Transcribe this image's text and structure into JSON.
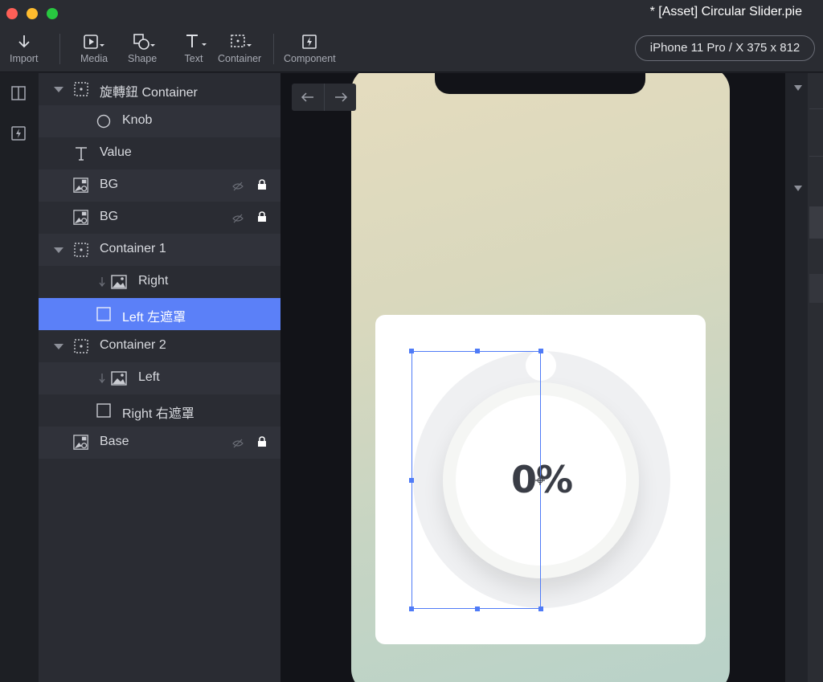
{
  "window": {
    "title": "* [Asset] Circular Slider.pie"
  },
  "toolbar": {
    "import_label": "Import",
    "media_label": "Media",
    "shape_label": "Shape",
    "text_label": "Text",
    "container_label": "Container",
    "component_label": "Component",
    "device_label": "iPhone 11 Pro / X  375 x 812"
  },
  "layers": [
    {
      "name": "旋轉鈕 Container",
      "icon": "container-icon",
      "expanded": true
    },
    {
      "name": "Knob",
      "icon": "ellipse-icon"
    },
    {
      "name": "Value",
      "icon": "text-icon"
    },
    {
      "name": "BG",
      "icon": "image-layer-icon",
      "hidden": true,
      "locked": true
    },
    {
      "name": "BG",
      "icon": "image-layer-icon",
      "hidden": true,
      "locked": true
    },
    {
      "name": "Container 1",
      "icon": "container-icon",
      "expanded": true
    },
    {
      "name": "Right",
      "icon": "image-icon",
      "masked": true
    },
    {
      "name": "Left 左遮罩",
      "icon": "rectangle-icon",
      "selected": true
    },
    {
      "name": "Container 2",
      "icon": "container-icon",
      "expanded": true
    },
    {
      "name": "Left",
      "icon": "image-icon",
      "masked": true
    },
    {
      "name": "Right 右遮罩",
      "icon": "rectangle-icon"
    },
    {
      "name": "Base",
      "icon": "image-layer-icon",
      "hidden": true,
      "locked": true
    }
  ],
  "canvas": {
    "value_text": "0%"
  },
  "colors": {
    "selection": "#5b80f8",
    "accent": "#4f7bf7",
    "panel": "#2a2c33"
  }
}
